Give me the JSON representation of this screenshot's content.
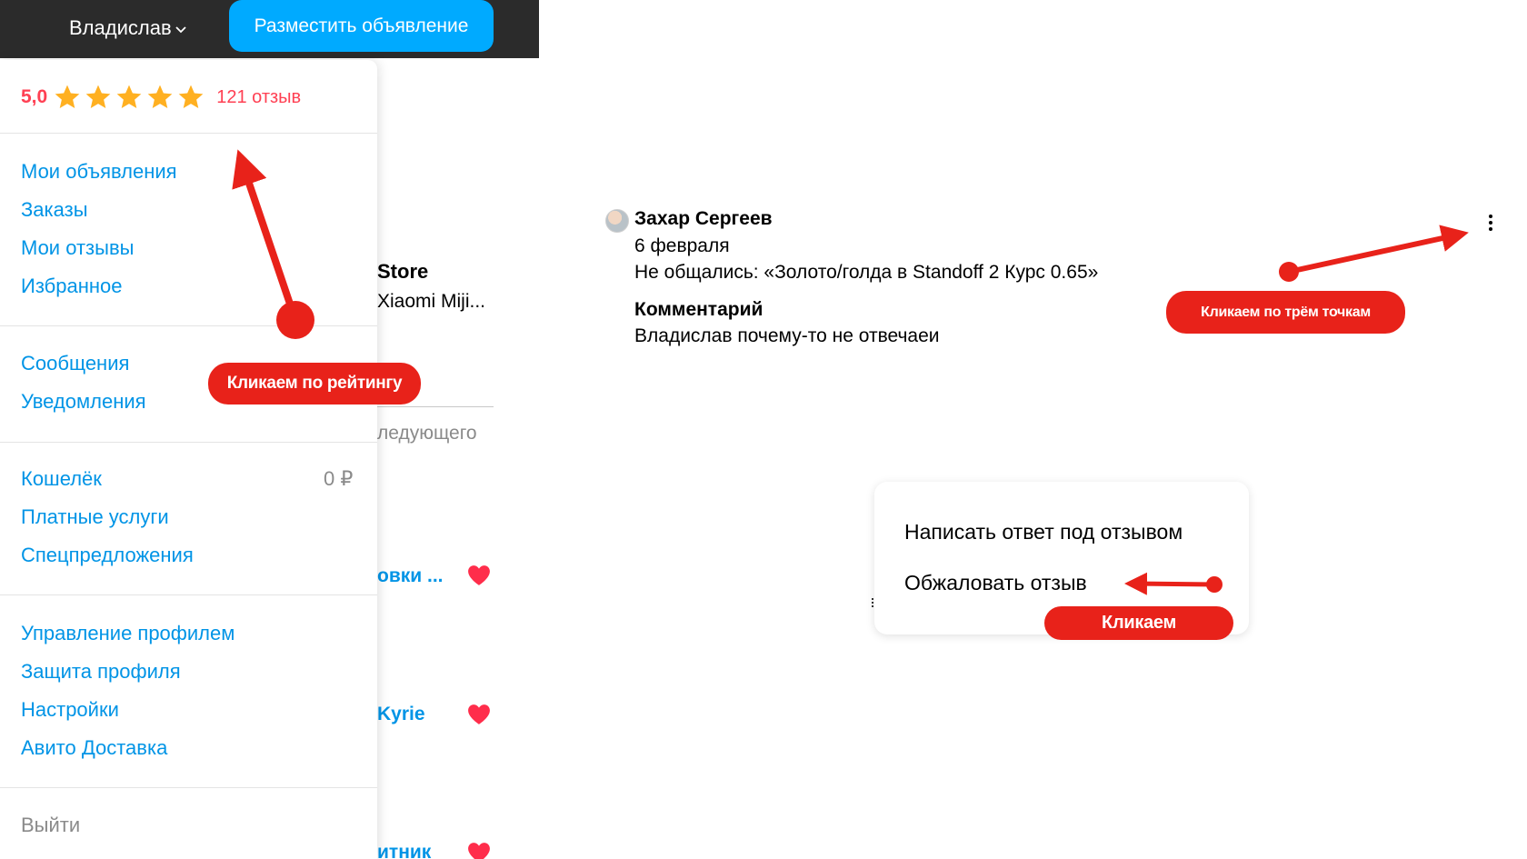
{
  "header": {
    "user_name": "Владислав",
    "post_ad_label": "Разместить объявление"
  },
  "menu": {
    "rating_value": "5,0",
    "stars": 5,
    "reviews_count": "121 отзыв",
    "items": [
      {
        "label": "Мои объявления"
      },
      {
        "label": "Заказы"
      },
      {
        "label": "Мои отзывы"
      },
      {
        "label": "Избранное"
      },
      {
        "label": "Сообщения"
      },
      {
        "label": "Уведомления"
      },
      {
        "label": "Кошелёк"
      },
      {
        "label": "Платные услуги"
      },
      {
        "label": "Спецпредложения"
      },
      {
        "label": "Управление профилем"
      },
      {
        "label": "Защита профиля"
      },
      {
        "label": "Настройки"
      },
      {
        "label": "Авито Доставка"
      },
      {
        "label": "Выйти"
      }
    ],
    "wallet_amount": "0 ₽"
  },
  "background": {
    "store": "Store",
    "subtitle": "Xiaomi Miji...",
    "next": "ледующего",
    "item1": "овки ...",
    "item2": "Kyrie",
    "item3": "итник"
  },
  "review": {
    "author": "Захар Сергеев",
    "date": "6 февраля",
    "deal": "Не общались: «Золото/голда в Standoff 2 Курс 0.65»",
    "comment_title": "Комментарий",
    "comment": "Владислав почему-то не отвечаеи"
  },
  "popup": {
    "reply": "Написать ответ под отзывом",
    "complain": "Обжаловать отзыв"
  },
  "annotations": {
    "click_rating": "Кликаем по рейтингу",
    "click_dots": "Кликаем по трём точкам",
    "click": "Кликаем"
  },
  "colors": {
    "accent_blue": "#00aaff",
    "link_blue": "#0094e6",
    "rating_red": "#ff4053",
    "star": "#ffb021",
    "annotation_red": "#e8221a",
    "topbar": "#2b2b2b"
  }
}
